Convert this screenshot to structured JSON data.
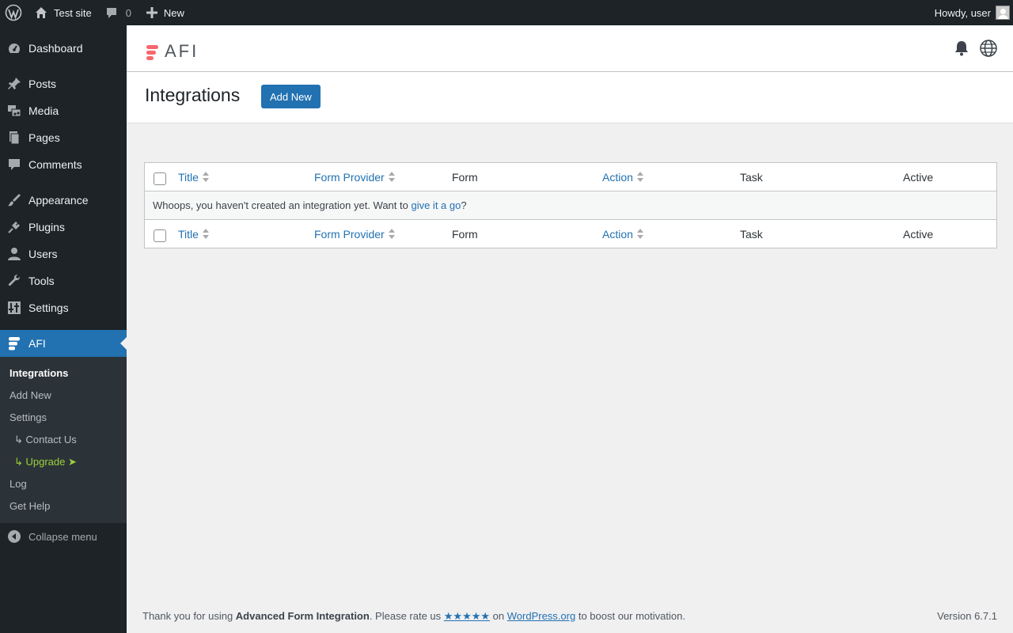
{
  "admin_bar": {
    "site_name": "Test site",
    "comments_count": "0",
    "new_label": "New",
    "greeting": "Howdy, user"
  },
  "sidebar": {
    "items": [
      {
        "label": "Dashboard",
        "icon": "dashboard-icon"
      },
      {
        "label": "Posts",
        "icon": "pushpin-icon"
      },
      {
        "label": "Media",
        "icon": "media-icon"
      },
      {
        "label": "Pages",
        "icon": "pages-icon"
      },
      {
        "label": "Comments",
        "icon": "comment-icon"
      },
      {
        "label": "Appearance",
        "icon": "brush-icon"
      },
      {
        "label": "Plugins",
        "icon": "plug-icon"
      },
      {
        "label": "Users",
        "icon": "user-icon"
      },
      {
        "label": "Tools",
        "icon": "wrench-icon"
      },
      {
        "label": "Settings",
        "icon": "settings-icon"
      },
      {
        "label": "AFI",
        "icon": "afi-logo-icon"
      }
    ],
    "submenu": [
      {
        "label": "Integrations"
      },
      {
        "label": "Add New"
      },
      {
        "label": "Settings"
      },
      {
        "label": "↳ Contact Us"
      },
      {
        "label": "↳ Upgrade ➤"
      },
      {
        "label": "Log"
      },
      {
        "label": "Get Help"
      }
    ],
    "collapse_label": "Collapse menu"
  },
  "header": {
    "logo_text": "AFI"
  },
  "page": {
    "title": "Integrations",
    "add_new_label": "Add New"
  },
  "table": {
    "columns": [
      "Title",
      "Form Provider",
      "Form",
      "Action",
      "Task",
      "Active"
    ],
    "empty_prefix": "Whoops, you haven't created an integration yet. Want to ",
    "empty_link": "give it a go",
    "empty_suffix": "?"
  },
  "footer": {
    "thanks_prefix": "Thank you for using ",
    "plugin_name": "Advanced Form Integration",
    "rate_text": ". Please rate us ",
    "stars": "★★★★★",
    "on_text": " on ",
    "wporg_link": "WordPress.org",
    "suffix": " to boost our motivation.",
    "version": "Version 6.7.1"
  },
  "colors": {
    "accent": "#2271b1",
    "admin_bar_bg": "#1d2327",
    "submenu_bg": "#2c3338",
    "upgrade_green": "#9cd23c",
    "afi_logo": "#f7676c"
  }
}
